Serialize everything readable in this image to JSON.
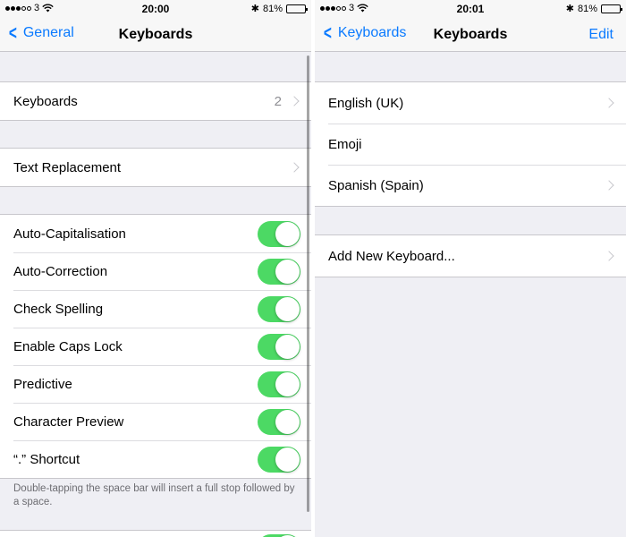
{
  "left": {
    "status": {
      "carrier": "3",
      "time": "20:00",
      "battery": "81%",
      "bluetooth": "✱",
      "wifi_icon": "wifi-icon"
    },
    "nav": {
      "back_label": "General",
      "title": "Keyboards"
    },
    "keyboards_row": {
      "label": "Keyboards",
      "count": "2"
    },
    "text_replacement": {
      "label": "Text Replacement"
    },
    "toggles": [
      {
        "label": "Auto-Capitalisation",
        "on": true
      },
      {
        "label": "Auto-Correction",
        "on": true
      },
      {
        "label": "Check Spelling",
        "on": true
      },
      {
        "label": "Enable Caps Lock",
        "on": true
      },
      {
        "label": "Predictive",
        "on": true
      },
      {
        "label": "Character Preview",
        "on": true
      },
      {
        "label": "“.” Shortcut",
        "on": true
      }
    ],
    "footer": "Double-tapping the space bar will insert a full stop followed by a space."
  },
  "right": {
    "status": {
      "carrier": "3",
      "time": "20:01",
      "battery": "81%",
      "bluetooth": "✱",
      "wifi_icon": "wifi-icon"
    },
    "nav": {
      "back_label": "Keyboards",
      "title": "Keyboards",
      "edit_label": "Edit"
    },
    "keyboards": [
      {
        "label": "English (UK)"
      },
      {
        "label": "Emoji"
      },
      {
        "label": "Spanish (Spain)"
      }
    ],
    "add_keyboard": {
      "label": "Add New Keyboard..."
    }
  },
  "colors": {
    "accent": "#0a7aff",
    "toggle_on": "#4cd964",
    "background": "#efeff4"
  }
}
